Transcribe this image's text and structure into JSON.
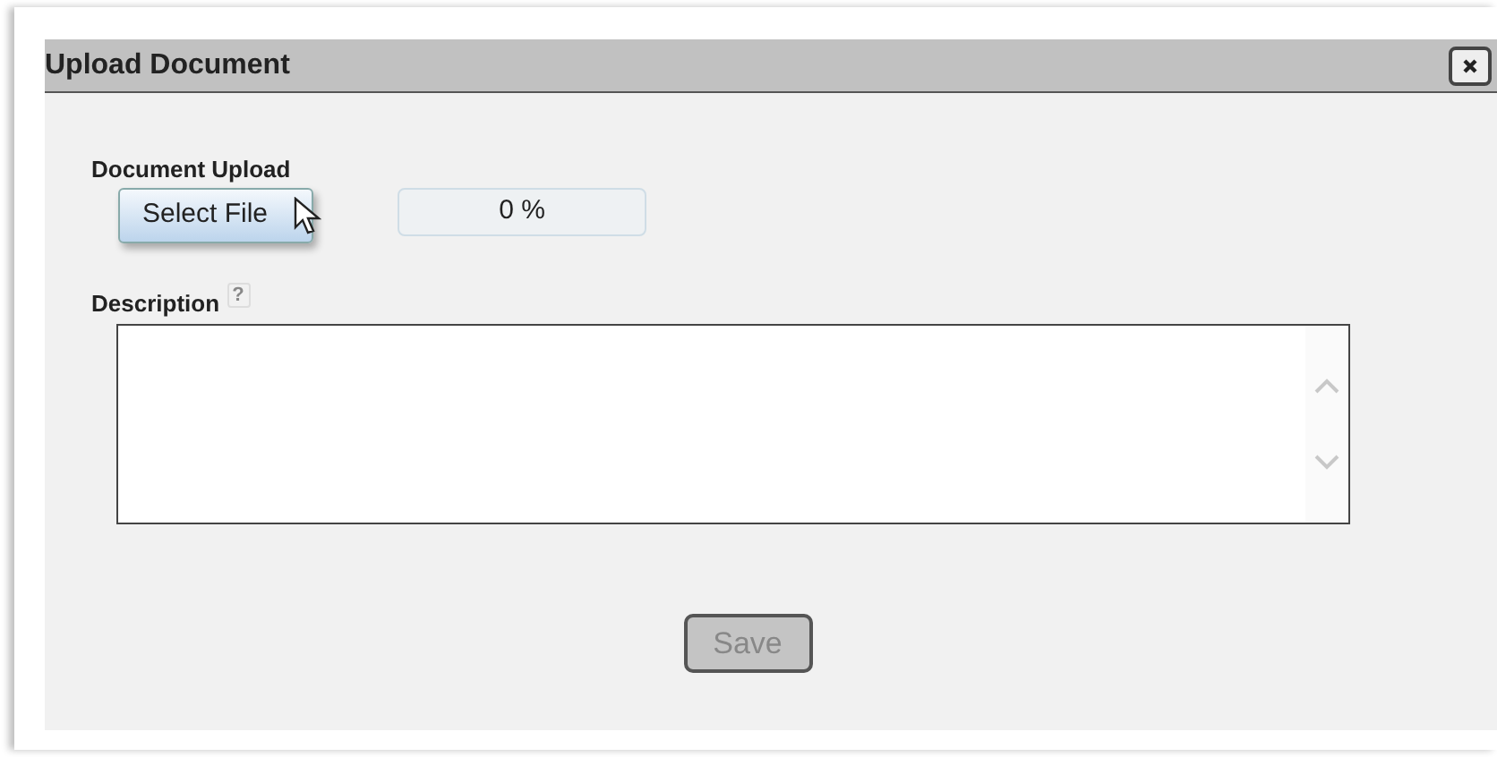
{
  "window": {
    "title": "Upload Document"
  },
  "upload": {
    "label": "Document Upload",
    "button": "Select File",
    "progress": {
      "reading": "0 %",
      "level": 0
    }
  },
  "description": {
    "label": "Description",
    "help": "?"
  },
  "save": {
    "label": "Save",
    "disabled": true
  }
}
